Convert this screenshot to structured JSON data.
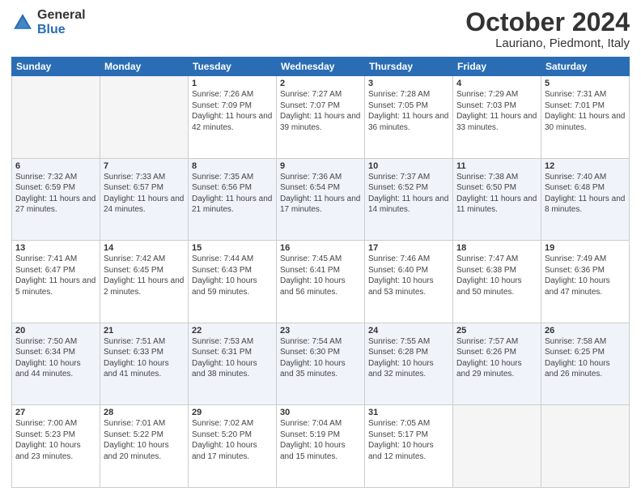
{
  "logo": {
    "general": "General",
    "blue": "Blue"
  },
  "title": "October 2024",
  "subtitle": "Lauriano, Piedmont, Italy",
  "headers": [
    "Sunday",
    "Monday",
    "Tuesday",
    "Wednesday",
    "Thursday",
    "Friday",
    "Saturday"
  ],
  "weeks": [
    [
      {
        "day": "",
        "info": ""
      },
      {
        "day": "",
        "info": ""
      },
      {
        "day": "1",
        "info": "Sunrise: 7:26 AM\nSunset: 7:09 PM\nDaylight: 11 hours and 42 minutes."
      },
      {
        "day": "2",
        "info": "Sunrise: 7:27 AM\nSunset: 7:07 PM\nDaylight: 11 hours and 39 minutes."
      },
      {
        "day": "3",
        "info": "Sunrise: 7:28 AM\nSunset: 7:05 PM\nDaylight: 11 hours and 36 minutes."
      },
      {
        "day": "4",
        "info": "Sunrise: 7:29 AM\nSunset: 7:03 PM\nDaylight: 11 hours and 33 minutes."
      },
      {
        "day": "5",
        "info": "Sunrise: 7:31 AM\nSunset: 7:01 PM\nDaylight: 11 hours and 30 minutes."
      }
    ],
    [
      {
        "day": "6",
        "info": "Sunrise: 7:32 AM\nSunset: 6:59 PM\nDaylight: 11 hours and 27 minutes."
      },
      {
        "day": "7",
        "info": "Sunrise: 7:33 AM\nSunset: 6:57 PM\nDaylight: 11 hours and 24 minutes."
      },
      {
        "day": "8",
        "info": "Sunrise: 7:35 AM\nSunset: 6:56 PM\nDaylight: 11 hours and 21 minutes."
      },
      {
        "day": "9",
        "info": "Sunrise: 7:36 AM\nSunset: 6:54 PM\nDaylight: 11 hours and 17 minutes."
      },
      {
        "day": "10",
        "info": "Sunrise: 7:37 AM\nSunset: 6:52 PM\nDaylight: 11 hours and 14 minutes."
      },
      {
        "day": "11",
        "info": "Sunrise: 7:38 AM\nSunset: 6:50 PM\nDaylight: 11 hours and 11 minutes."
      },
      {
        "day": "12",
        "info": "Sunrise: 7:40 AM\nSunset: 6:48 PM\nDaylight: 11 hours and 8 minutes."
      }
    ],
    [
      {
        "day": "13",
        "info": "Sunrise: 7:41 AM\nSunset: 6:47 PM\nDaylight: 11 hours and 5 minutes."
      },
      {
        "day": "14",
        "info": "Sunrise: 7:42 AM\nSunset: 6:45 PM\nDaylight: 11 hours and 2 minutes."
      },
      {
        "day": "15",
        "info": "Sunrise: 7:44 AM\nSunset: 6:43 PM\nDaylight: 10 hours and 59 minutes."
      },
      {
        "day": "16",
        "info": "Sunrise: 7:45 AM\nSunset: 6:41 PM\nDaylight: 10 hours and 56 minutes."
      },
      {
        "day": "17",
        "info": "Sunrise: 7:46 AM\nSunset: 6:40 PM\nDaylight: 10 hours and 53 minutes."
      },
      {
        "day": "18",
        "info": "Sunrise: 7:47 AM\nSunset: 6:38 PM\nDaylight: 10 hours and 50 minutes."
      },
      {
        "day": "19",
        "info": "Sunrise: 7:49 AM\nSunset: 6:36 PM\nDaylight: 10 hours and 47 minutes."
      }
    ],
    [
      {
        "day": "20",
        "info": "Sunrise: 7:50 AM\nSunset: 6:34 PM\nDaylight: 10 hours and 44 minutes."
      },
      {
        "day": "21",
        "info": "Sunrise: 7:51 AM\nSunset: 6:33 PM\nDaylight: 10 hours and 41 minutes."
      },
      {
        "day": "22",
        "info": "Sunrise: 7:53 AM\nSunset: 6:31 PM\nDaylight: 10 hours and 38 minutes."
      },
      {
        "day": "23",
        "info": "Sunrise: 7:54 AM\nSunset: 6:30 PM\nDaylight: 10 hours and 35 minutes."
      },
      {
        "day": "24",
        "info": "Sunrise: 7:55 AM\nSunset: 6:28 PM\nDaylight: 10 hours and 32 minutes."
      },
      {
        "day": "25",
        "info": "Sunrise: 7:57 AM\nSunset: 6:26 PM\nDaylight: 10 hours and 29 minutes."
      },
      {
        "day": "26",
        "info": "Sunrise: 7:58 AM\nSunset: 6:25 PM\nDaylight: 10 hours and 26 minutes."
      }
    ],
    [
      {
        "day": "27",
        "info": "Sunrise: 7:00 AM\nSunset: 5:23 PM\nDaylight: 10 hours and 23 minutes."
      },
      {
        "day": "28",
        "info": "Sunrise: 7:01 AM\nSunset: 5:22 PM\nDaylight: 10 hours and 20 minutes."
      },
      {
        "day": "29",
        "info": "Sunrise: 7:02 AM\nSunset: 5:20 PM\nDaylight: 10 hours and 17 minutes."
      },
      {
        "day": "30",
        "info": "Sunrise: 7:04 AM\nSunset: 5:19 PM\nDaylight: 10 hours and 15 minutes."
      },
      {
        "day": "31",
        "info": "Sunrise: 7:05 AM\nSunset: 5:17 PM\nDaylight: 10 hours and 12 minutes."
      },
      {
        "day": "",
        "info": ""
      },
      {
        "day": "",
        "info": ""
      }
    ]
  ]
}
